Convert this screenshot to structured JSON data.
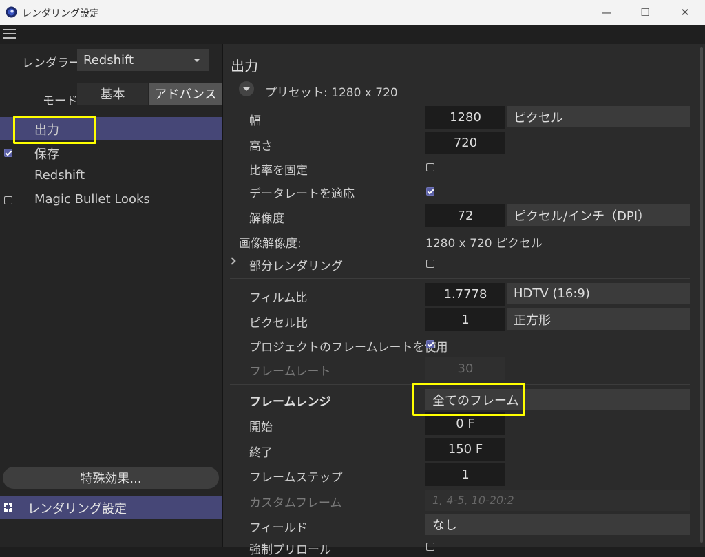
{
  "window": {
    "title": "レンダリング設定",
    "minimize": "—",
    "maximize": "☐",
    "close": "✕"
  },
  "left": {
    "renderer_label": "レンダラー",
    "renderer_value": "Redshift",
    "mode_label": "モード",
    "mode_basic": "基本",
    "mode_advanced": "アドバンス",
    "nav": [
      "出力",
      "保存",
      "Redshift",
      "Magic Bullet Looks"
    ],
    "effects_button": "特殊効果...",
    "render_setting": "レンダリング設定"
  },
  "right": {
    "heading": "出力",
    "preset": "プリセット: 1280 x 720",
    "width_label": "幅",
    "width_value": "1280",
    "width_unit": "ピクセル",
    "height_label": "高さ",
    "height_value": "720",
    "lock_ratio_label": "比率を固定",
    "apply_datarate_label": "データレートを適応",
    "resolution_label": "解像度",
    "resolution_value": "72",
    "resolution_unit": "ピクセル/インチ（DPI）",
    "image_res_label": "画像解像度:",
    "image_res_value": "1280 x 720 ピクセル",
    "partial_render_label": "部分レンダリング",
    "film_aspect_label": "フィルム比",
    "film_aspect_value": "1.7778",
    "film_aspect_preset": "HDTV (16:9)",
    "pixel_aspect_label": "ピクセル比",
    "pixel_aspect_value": "1",
    "pixel_aspect_preset": "正方形",
    "use_project_fps_label": "プロジェクトのフレームレートを使用",
    "fps_label": "フレームレート",
    "fps_value": "30",
    "frame_range_label": "フレームレンジ",
    "frame_range_value": "全てのフレーム",
    "start_label": "開始",
    "start_value": "0 F",
    "end_label": "終了",
    "end_value": "150 F",
    "frame_step_label": "フレームステップ",
    "frame_step_value": "1",
    "custom_frames_label": "カスタムフレーム",
    "custom_frames_placeholder": "1, 4-5, 10-20:2",
    "field_label": "フィールド",
    "field_value": "なし",
    "preroll_label": "強制プリロール"
  }
}
